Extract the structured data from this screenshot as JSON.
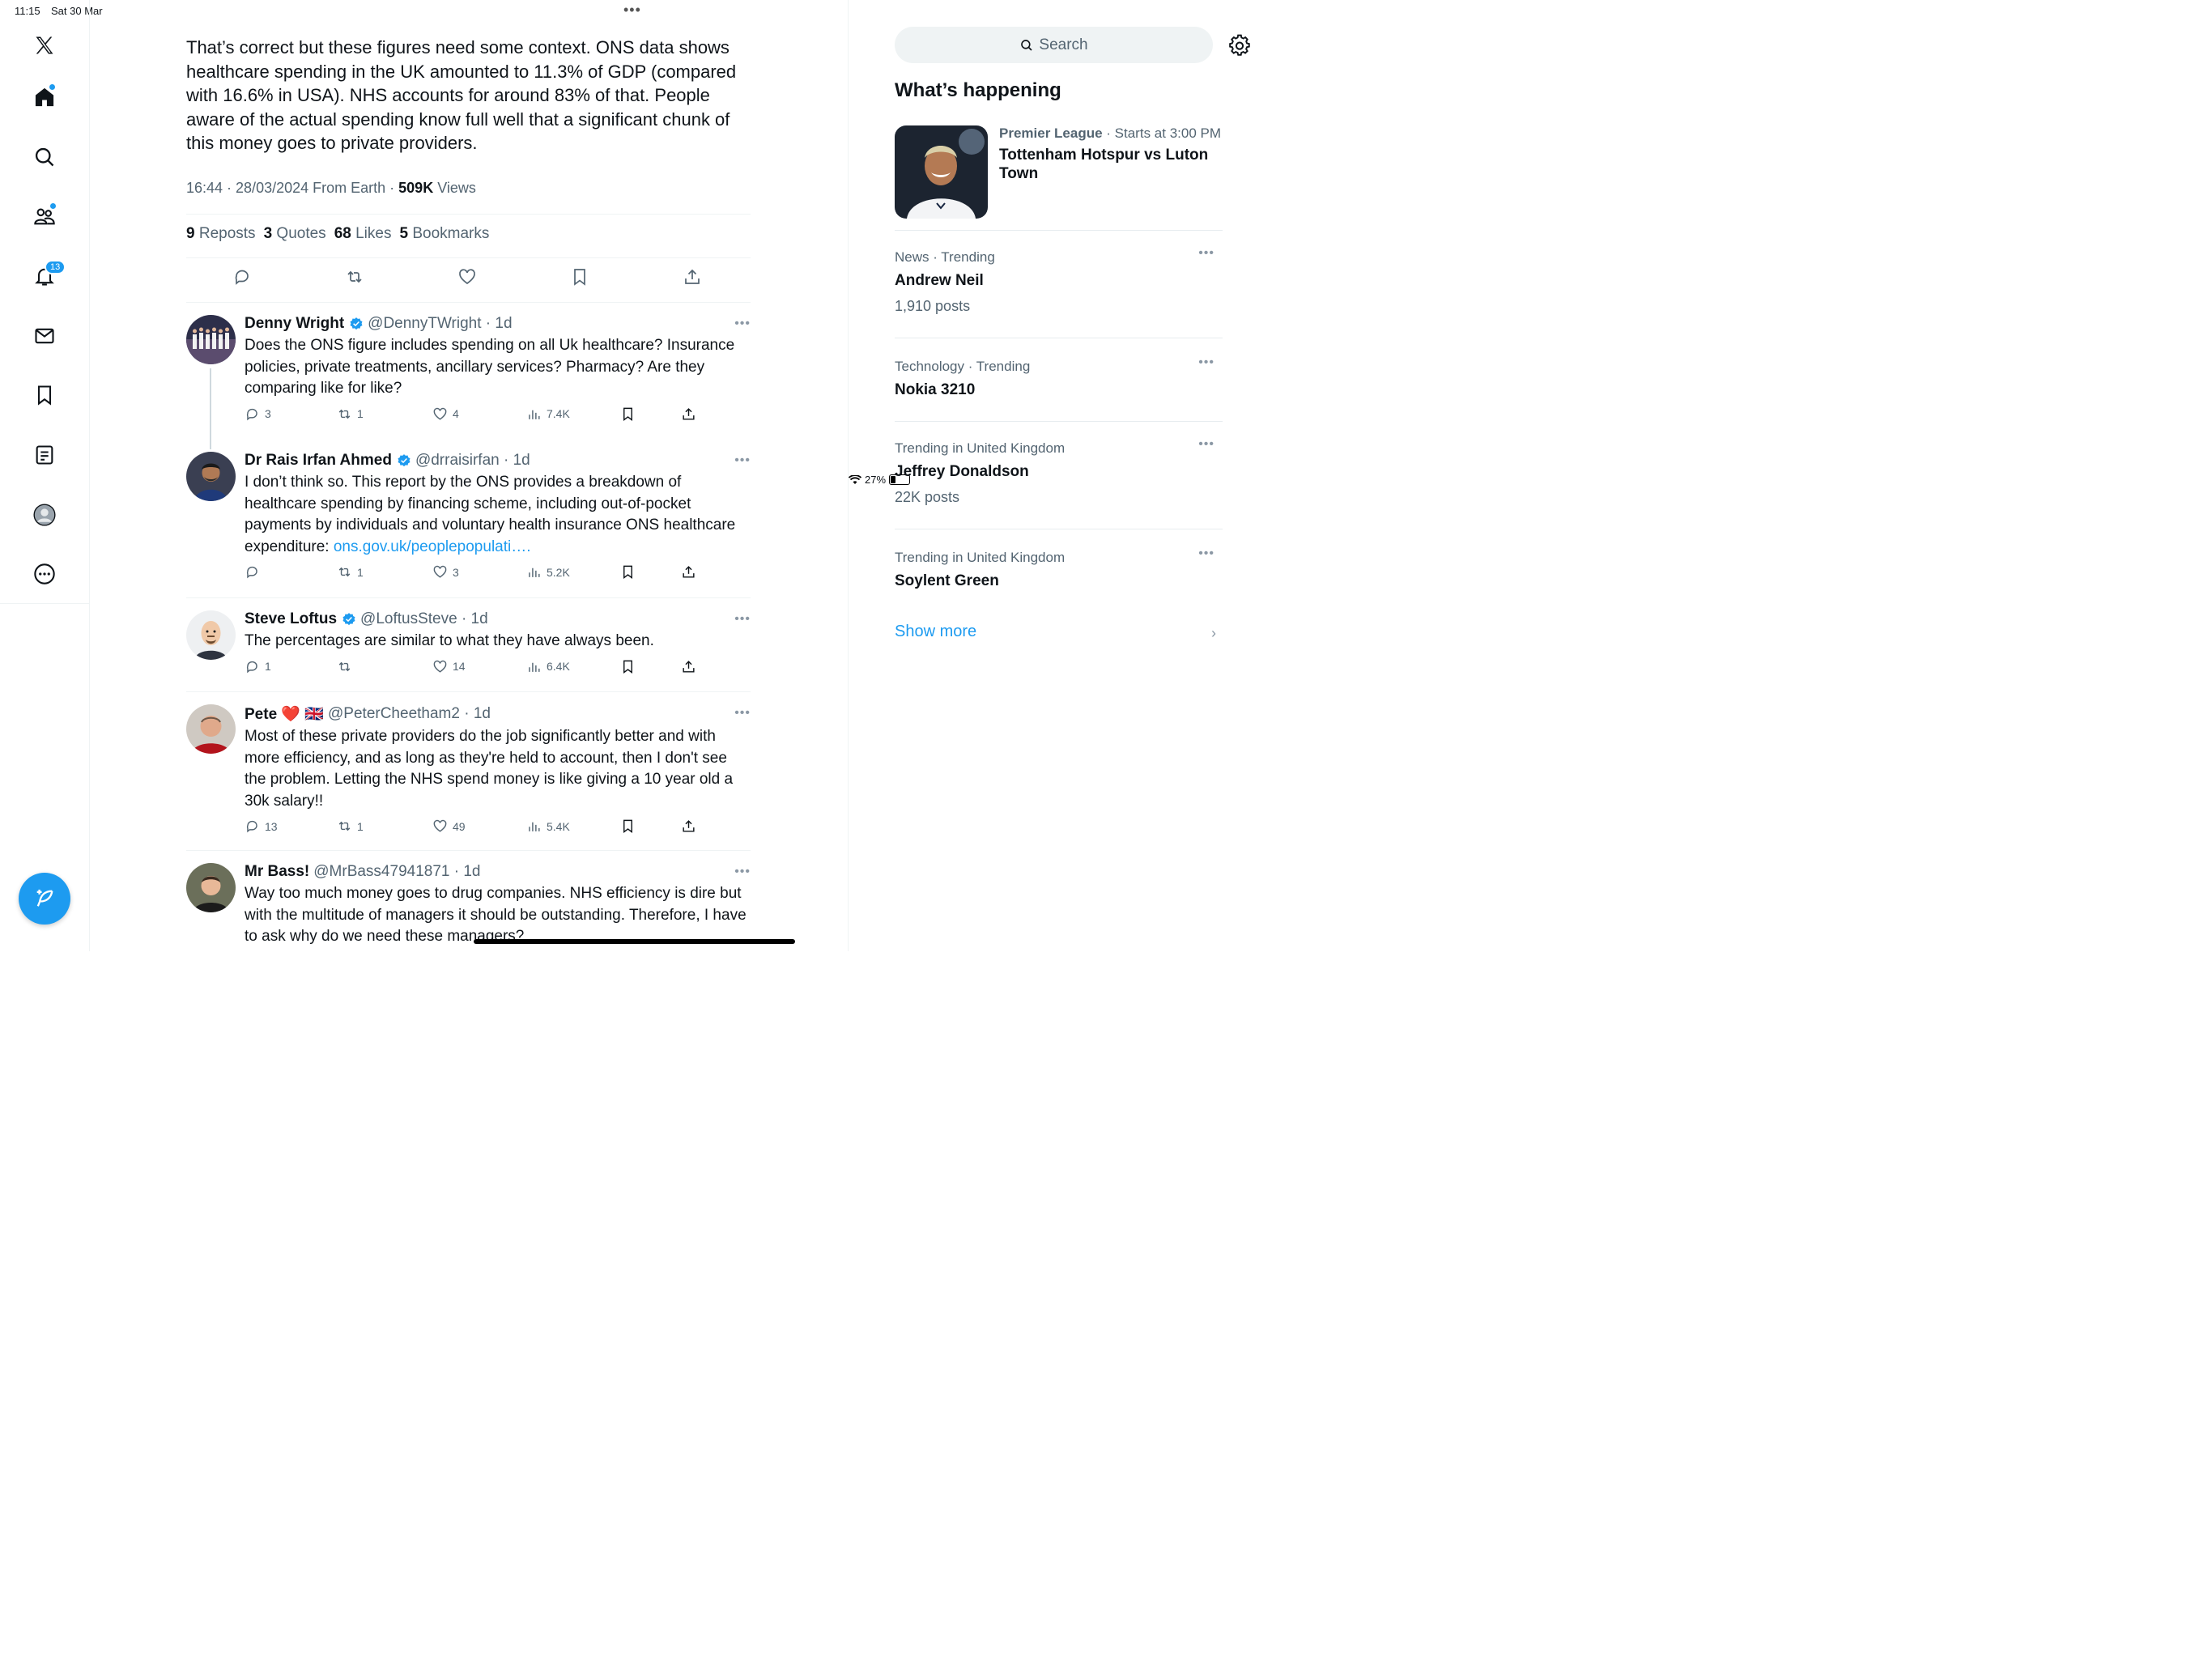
{
  "status_bar": {
    "time": "11:15",
    "date": "Sat 30 Mar",
    "battery": "27%"
  },
  "nav": {
    "notifications_badge": "13"
  },
  "tweet": {
    "text": "That’s correct but these figures need some context. ONS data shows healthcare spending in the UK amounted to 11.3% of GDP (compared with 16.6% in USA). NHS accounts for around 83% of that. People aware of the actual spending know full well that a significant chunk of this money goes to private providers.",
    "meta_time": "16:44 · 28/03/2024 From Earth · ",
    "views_count": "509K",
    "views_label": " Views",
    "stats": [
      {
        "count": "9",
        "label": "Reposts"
      },
      {
        "count": "3",
        "label": "Quotes"
      },
      {
        "count": "68",
        "label": "Likes"
      },
      {
        "count": "5",
        "label": "Bookmarks"
      }
    ]
  },
  "replies": [
    {
      "name": "Denny Wright",
      "handle": "@DennyTWright · 1d",
      "verified": true,
      "text": "Does the ONS figure includes spending on all Uk healthcare?  Insurance policies, private treatments, ancillary services?  Pharmacy?  Are they comparing like for like?",
      "link": "",
      "replies": "3",
      "reposts": "1",
      "likes": "4",
      "views": "7.4K"
    },
    {
      "name": "Dr Rais Irfan Ahmed",
      "handle": "@drraisirfan · 1d",
      "verified": true,
      "text": "I don’t think so. This report by the ONS provides a breakdown of healthcare spending by financing scheme, including out-of-pocket payments by individuals and voluntary health insurance ONS healthcare expenditure: ",
      "link": "ons.gov.uk/peoplepopulati….",
      "replies": "",
      "reposts": "1",
      "likes": "3",
      "views": "5.2K"
    },
    {
      "name": "Steve Loftus",
      "handle": "@LoftusSteve · 1d",
      "verified": true,
      "text": "The percentages are similar to what they have always been.",
      "link": "",
      "replies": "1",
      "reposts": "",
      "likes": "14",
      "views": "6.4K"
    },
    {
      "name": "Pete ❤️ 🇬🇧",
      "handle": "@PeterCheetham2 · 1d",
      "verified": false,
      "text": "Most of these private providers do the job significantly better and with more efficiency, and as long as they're held to account, then I don't see the problem.  Letting the NHS spend money is like giving a 10 year old a 30k salary!!",
      "link": "",
      "replies": "13",
      "reposts": "1",
      "likes": "49",
      "views": "5.4K"
    },
    {
      "name": "Mr Bass!",
      "handle": "@MrBass47941871 · 1d",
      "verified": false,
      "text": "Way too much money goes to drug companies. NHS efficiency is dire but with the multitude of managers it should be outstanding. Therefore, I have to ask why do we need these managers?",
      "link": "",
      "replies": "",
      "reposts": "",
      "likes": "",
      "views": ""
    }
  ],
  "sidebar": {
    "search_placeholder": "Search",
    "whats_happening": "What’s happening",
    "featured": {
      "category": "Premier League",
      "when": " · Starts at 3:00 PM",
      "title": "Tottenham Hotspur vs Luton Town"
    },
    "trends": [
      {
        "category": "News · Trending",
        "title": "Andrew Neil",
        "posts": "1,910 posts"
      },
      {
        "category": "Technology · Trending",
        "title": "Nokia 3210",
        "posts": ""
      },
      {
        "category": "Trending in United Kingdom",
        "title": "Jeffrey Donaldson",
        "posts": "22K posts"
      },
      {
        "category": "Trending in United Kingdom",
        "title": "Soylent Green",
        "posts": ""
      }
    ],
    "show_more": "Show more"
  },
  "colors": {
    "accent": "#1d9bf0",
    "text": "#0f1419",
    "secondary": "#536471"
  }
}
